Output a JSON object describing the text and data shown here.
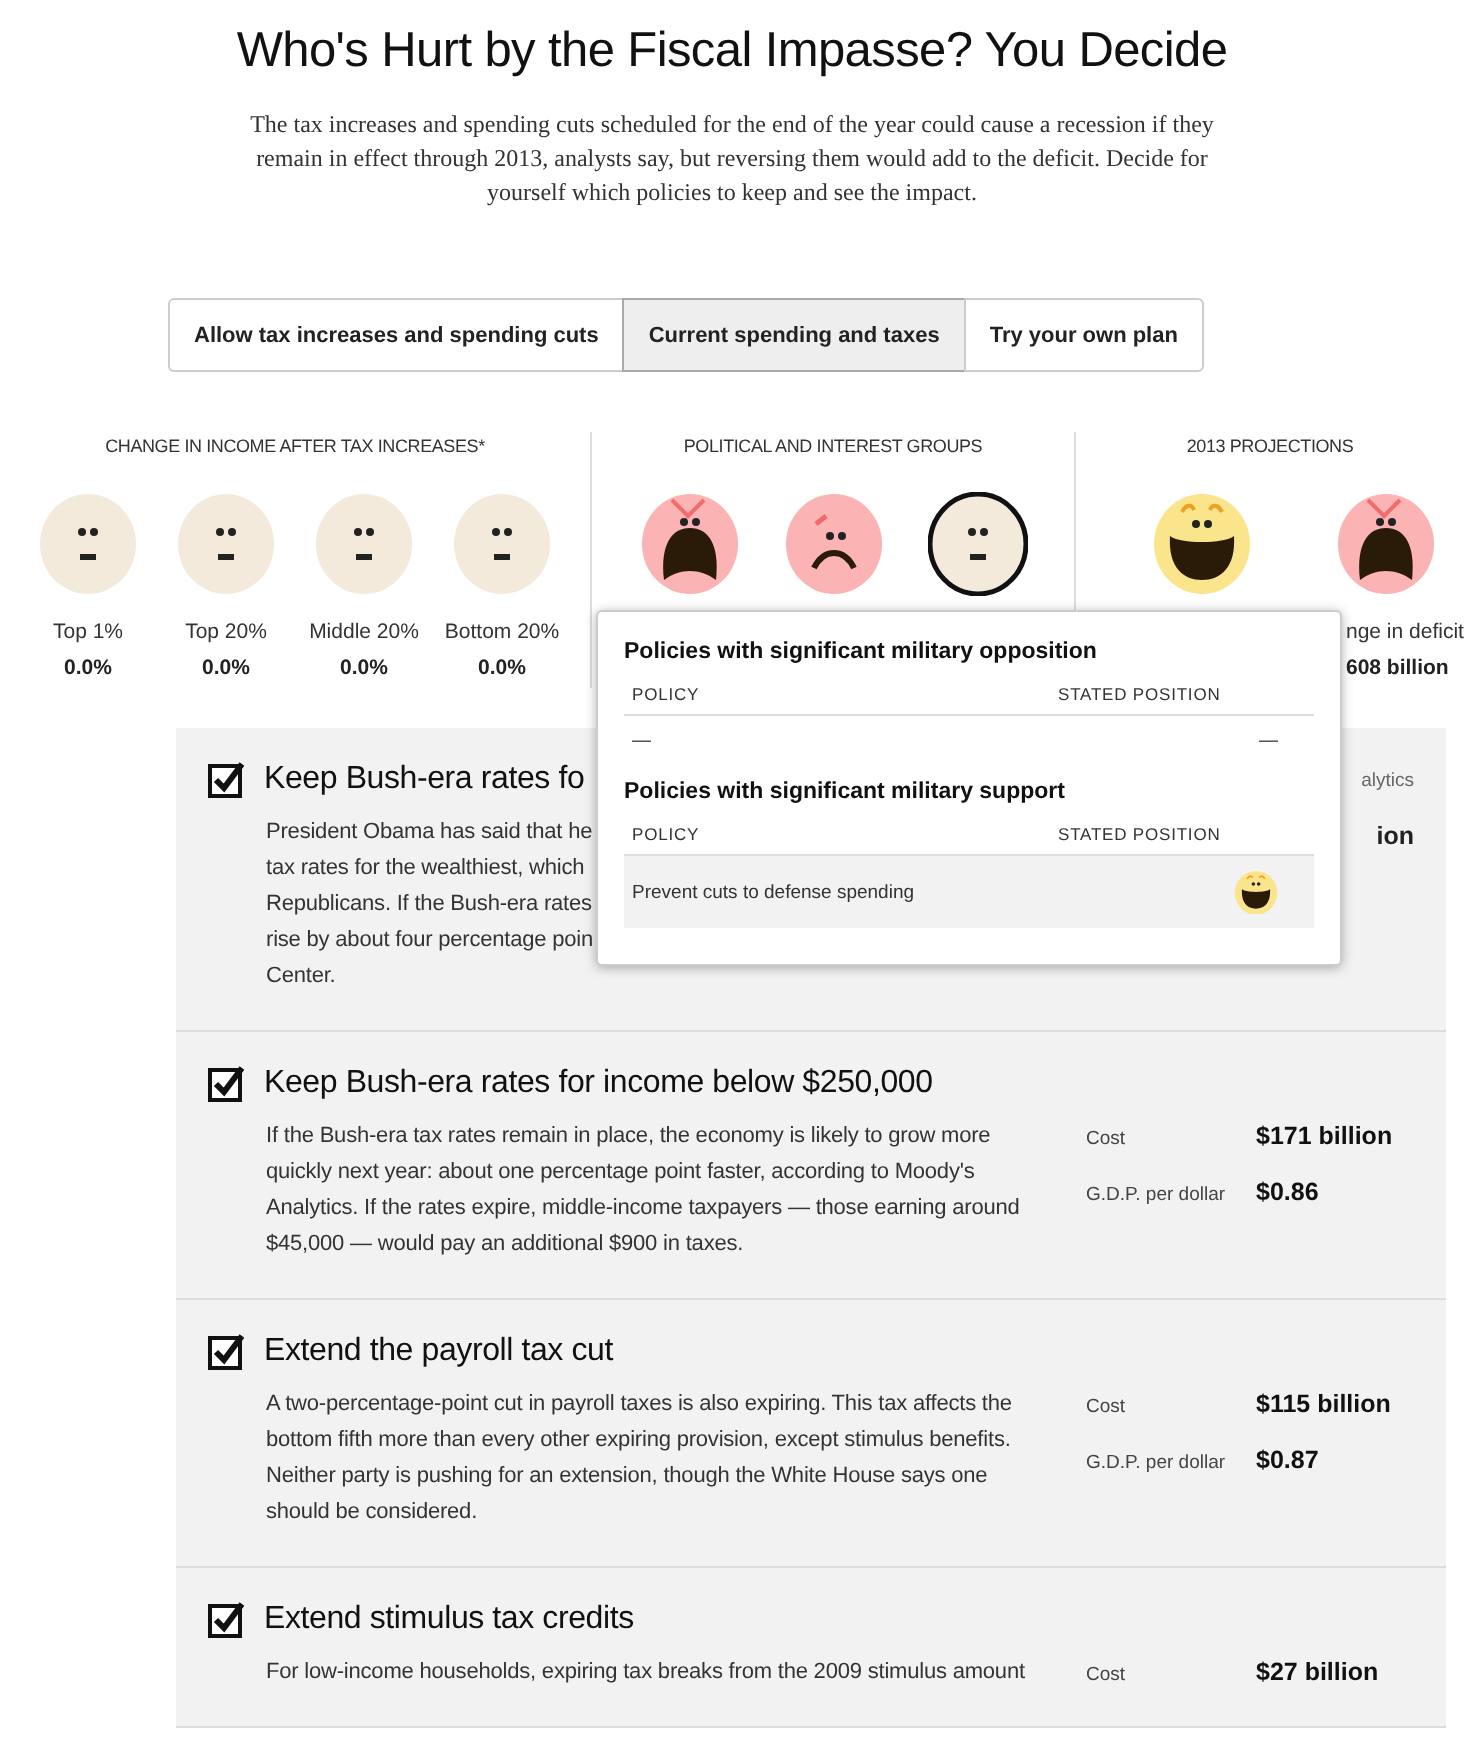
{
  "title": "Who's Hurt by the Fiscal Impasse? You Decide",
  "intro": "The tax increases and spending cuts scheduled for the end of the year could cause a recession if they remain in effect through 2013, analysts say, but reversing them would add to the deficit. Decide for yourself which policies to keep and see the impact.",
  "tabs": [
    {
      "label": "Allow tax increases and spending cuts",
      "selected": false
    },
    {
      "label": "Current spending and taxes",
      "selected": true
    },
    {
      "label": "Try your own plan",
      "selected": false
    }
  ],
  "income": {
    "heading": "CHANGE IN INCOME AFTER TAX INCREASES*",
    "items": [
      {
        "kind": "neutral",
        "label": "Top 1%",
        "value": "0.0%"
      },
      {
        "kind": "neutral",
        "label": "Top 20%",
        "value": "0.0%"
      },
      {
        "kind": "neutral",
        "label": "Middle 20%",
        "value": "0.0%"
      },
      {
        "kind": "neutral",
        "label": "Bottom 20%",
        "value": "0.0%"
      }
    ]
  },
  "groups": {
    "heading": "POLITICAL AND INTEREST GROUPS",
    "items": [
      {
        "kind": "screaming",
        "selected": false
      },
      {
        "kind": "sad",
        "selected": false
      },
      {
        "kind": "neutral",
        "selected": true
      }
    ]
  },
  "projections": {
    "heading": "2013 PROJECTIONS",
    "items": [
      {
        "kind": "happy"
      },
      {
        "kind": "screaming",
        "label": "nge in deficit",
        "value": "608 billion"
      }
    ]
  },
  "tooltip": {
    "sections": [
      {
        "heading": "Policies with significant military opposition",
        "columns": [
          "POLICY",
          "STATED POSITION"
        ],
        "rows": [
          {
            "policy": "—",
            "position": "—"
          }
        ]
      },
      {
        "heading": "Policies with significant military support",
        "columns": [
          "POLICY",
          "STATED POSITION"
        ],
        "rows": [
          {
            "policy": "Prevent cuts to defense spending",
            "kind": "happy"
          }
        ]
      }
    ]
  },
  "policies": [
    {
      "checked": true,
      "title": "Keep Bush-era rates fo",
      "description_lines": [
        "President Obama has said that he",
        "tax rates for the wealthiest, which",
        "Republicans. If the Bush-era rates",
        "rise by about four percentage poin",
        "Center."
      ],
      "side_note": "alytics",
      "side_value": "ion"
    },
    {
      "checked": true,
      "title": "Keep Bush-era rates for income below $250,000",
      "description": "If the Bush-era tax rates remain in place, the economy is likely to grow more quickly next year: about one percentage point faster, according to Moody's Analytics. If the rates expire, middle-income taxpayers — those earning around $45,000 — would pay an additional $900 in taxes.",
      "stats": [
        {
          "label": "Cost",
          "value": "$171 billion"
        },
        {
          "label": "G.D.P. per dollar",
          "value": "$0.86"
        }
      ]
    },
    {
      "checked": true,
      "title": "Extend the payroll tax cut",
      "description": "A two-percentage-point cut in payroll taxes is also expiring. This tax affects the bottom fifth more than every other expiring provision, except stimulus benefits. Neither party is pushing for an extension, though the White House says one should be considered.",
      "stats": [
        {
          "label": "Cost",
          "value": "$115 billion"
        },
        {
          "label": "G.D.P. per dollar",
          "value": "$0.87"
        }
      ]
    },
    {
      "checked": true,
      "title": "Extend stimulus tax credits",
      "description_lines": [
        "For low-income households, expiring tax breaks from the 2009 stimulus amount"
      ],
      "stats": [
        {
          "label": "Cost",
          "value": "$27 billion"
        }
      ]
    }
  ]
}
